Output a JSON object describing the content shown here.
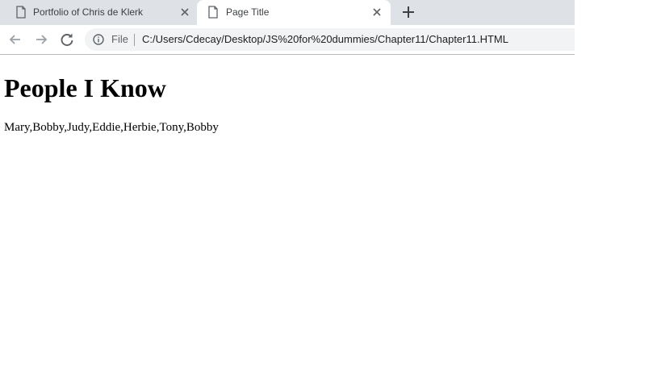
{
  "tabs": [
    {
      "title": "Portfolio of Chris de Klerk",
      "icon": "page-icon",
      "active": false
    },
    {
      "title": "Page Title",
      "icon": "page-icon",
      "active": true
    }
  ],
  "new_tab_icon": "plus-icon",
  "toolbar": {
    "back_icon": "arrow-left-icon",
    "forward_icon": "arrow-right-icon",
    "reload_icon": "reload-icon"
  },
  "address_bar": {
    "info_icon": "info-icon",
    "scheme_label": "File",
    "url": "C:/Users/Cdecay/Desktop/JS%20for%20dummies/Chapter11/Chapter11.HTML"
  },
  "page": {
    "heading": "People I Know",
    "people_list": "Mary,Bobby,Judy,Eddie,Herbie,Tony,Bobby"
  },
  "colors": {
    "tabstrip_bg": "#dee1e6",
    "omnibox_bg": "#f1f3f4",
    "icon_gray": "#5f6368",
    "text_dark": "#202124"
  }
}
